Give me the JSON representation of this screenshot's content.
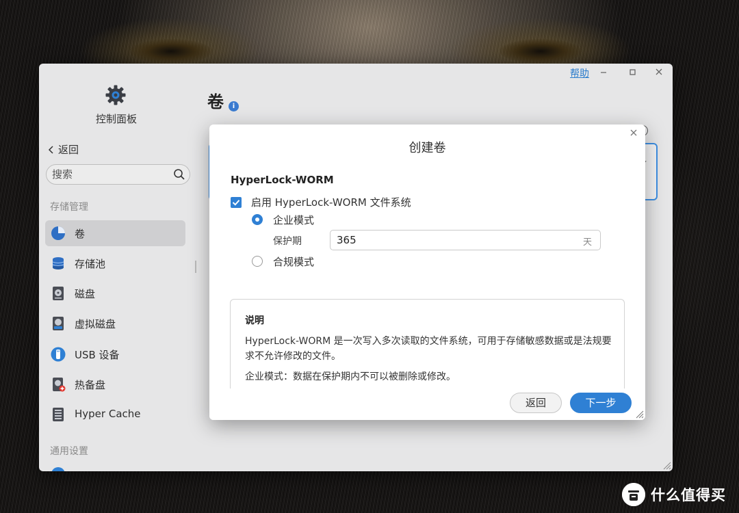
{
  "window": {
    "help_label": "帮助",
    "app_title": "控制面板",
    "back_label": "返回",
    "search": {
      "placeholder": "搜索"
    },
    "page_title": "卷",
    "info_icon": "info-icon",
    "sections": {
      "storage": "存储管理",
      "general": "通用设置"
    },
    "nav_items": [
      {
        "label": "卷",
        "icon": "volume-pie-icon",
        "active": true
      },
      {
        "label": "存储池",
        "icon": "storage-pool-icon",
        "active": false
      },
      {
        "label": "磁盘",
        "icon": "disk-icon",
        "active": false
      },
      {
        "label": "虚拟磁盘",
        "icon": "virtual-disk-icon",
        "active": false
      },
      {
        "label": "USB 设备",
        "icon": "usb-icon",
        "active": false
      },
      {
        "label": "热备盘",
        "icon": "hot-spare-icon",
        "active": false
      },
      {
        "label": "Hyper Cache",
        "icon": "hyper-cache-icon",
        "active": false
      }
    ]
  },
  "dialog": {
    "title": "创建卷",
    "section_title": "HyperLock-WORM",
    "enable_label": "启用 HyperLock-WORM 文件系统",
    "enable_checked": true,
    "mode_enterprise": "企业模式",
    "mode_compliance": "合规模式",
    "selected_mode": "企业模式",
    "retention_label": "保护期",
    "retention_value": "365",
    "retention_unit": "天",
    "description": {
      "title": "说明",
      "text": "HyperLock-WORM 是一次写入多次读取的文件系统，可用于存储敏感数据或是法规要求不允许修改的文件。",
      "enterprise_note": "企业模式：数据在保护期内不可以被删除或修改。"
    },
    "buttons": {
      "back": "返回",
      "next": "下一步"
    }
  },
  "watermark": {
    "text": "什么值得买",
    "logo": "值"
  },
  "colors": {
    "accent": "#2f80d4",
    "active_nav": "#cfcfd1",
    "window_bg": "#e6e6e7"
  }
}
